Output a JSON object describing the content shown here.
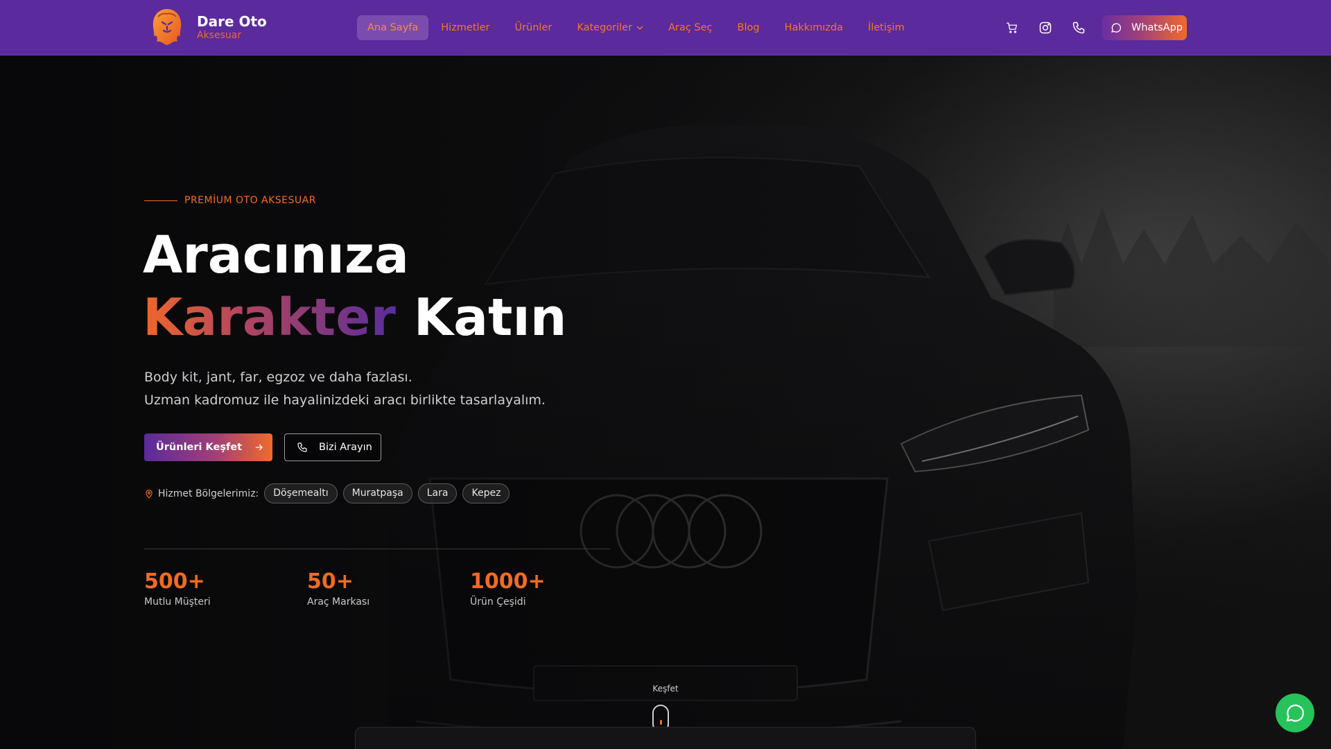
{
  "brand": {
    "name": "Dare Oto",
    "tagline": "Aksesuar"
  },
  "nav": {
    "items": [
      {
        "label": "Ana Sayfa",
        "active": true
      },
      {
        "label": "Hizmetler"
      },
      {
        "label": "Ürünler"
      },
      {
        "label": "Kategoriler",
        "dropdown": true
      },
      {
        "label": "Araç Seç"
      },
      {
        "label": "Blog"
      },
      {
        "label": "Hakkımızda"
      },
      {
        "label": "İletişim"
      }
    ],
    "whatsapp_label": "WhatsApp"
  },
  "hero": {
    "eyebrow": "PREMİUM OTO AKSESUAR",
    "title_line1": "Aracınıza",
    "title_highlight": "Karakter",
    "title_line2_rest": "Katın",
    "subtitle_line1": "Body kit, jant, far, egzoz ve daha fazlası.",
    "subtitle_line2": "Uzman kadromuz ile hayalinizdeki aracı birlikte tasarlayalım.",
    "cta_primary": "Ürünleri Keşfet",
    "cta_secondary": "Bizi Arayın",
    "regions_label": "Hizmet Bölgelerimiz:",
    "regions": [
      "Döşemealtı",
      "Muratpaşa",
      "Lara",
      "Kepez"
    ],
    "stats": [
      {
        "value": "500+",
        "label": "Mutlu Müşteri"
      },
      {
        "value": "50+",
        "label": "Araç Markası"
      },
      {
        "value": "1000+",
        "label": "Ürün Çeşidi"
      }
    ],
    "scroll_label": "Keşfet"
  },
  "colors": {
    "nav_bg": "#5b2a9c",
    "accent_orange": "#f26b24",
    "accent_purple": "#5a2a9a",
    "whatsapp_green": "#25c35a"
  },
  "icons": [
    "lion-logo-icon",
    "chevron-down-icon",
    "cart-icon",
    "instagram-icon",
    "phone-icon",
    "whatsapp-icon",
    "arrow-right-icon",
    "map-pin-icon"
  ]
}
